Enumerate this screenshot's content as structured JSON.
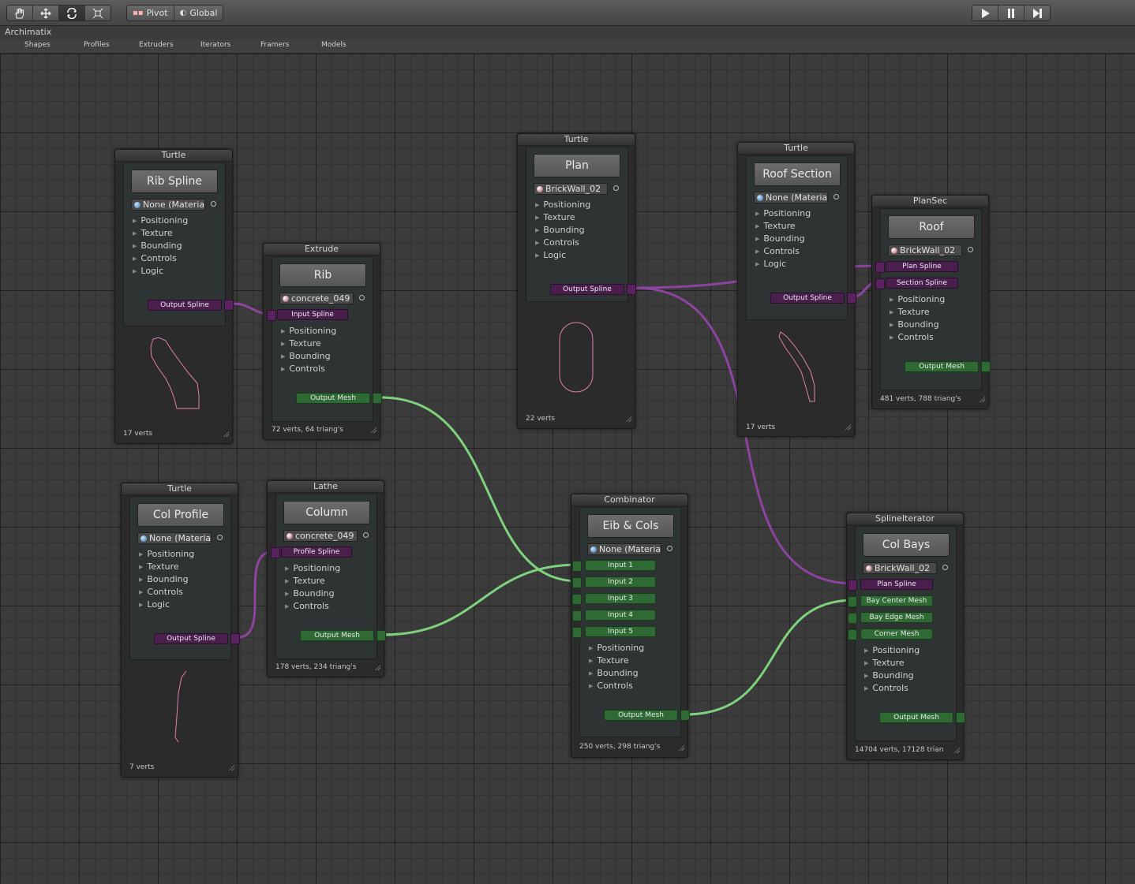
{
  "toolbar": {
    "tools": [
      "hand-icon",
      "move-icon",
      "rotate-icon",
      "scale-icon"
    ],
    "pivot": "Pivot",
    "global": "Global",
    "playback": [
      "play-icon",
      "pause-icon",
      "step-icon"
    ]
  },
  "window": {
    "title": "Archimatix"
  },
  "tabs": [
    "Shapes",
    "Profiles",
    "Extruders",
    "Iterators",
    "Framers",
    "Models"
  ],
  "colors": {
    "spline_wire": "#8c44a0",
    "mesh_wire": "#7ed27e",
    "shape_stroke": "#e47eb0"
  },
  "nodes": {
    "rib_spline": {
      "type": "Turtle",
      "name": "Rib Spline",
      "material": "None (Material",
      "items": [
        "Positioning",
        "Texture",
        "Bounding",
        "Controls",
        "Logic"
      ],
      "output": "Output Spline",
      "stats": "17 verts"
    },
    "rib": {
      "type": "Extrude",
      "name": "Rib",
      "material": "concrete_049",
      "input": "Input Spline",
      "items": [
        "Positioning",
        "Texture",
        "Bounding",
        "Controls"
      ],
      "output": "Output Mesh",
      "stats": "72 verts, 64 triang's"
    },
    "plan": {
      "type": "Turtle",
      "name": "Plan",
      "material": "BrickWall_02",
      "items": [
        "Positioning",
        "Texture",
        "Bounding",
        "Controls",
        "Logic"
      ],
      "output": "Output Spline",
      "stats": "22 verts"
    },
    "roof_section": {
      "type": "Turtle",
      "name": "Roof Section",
      "material": "None (Material",
      "items": [
        "Positioning",
        "Texture",
        "Bounding",
        "Controls",
        "Logic"
      ],
      "output": "Output Spline",
      "stats": "17 verts"
    },
    "roof": {
      "type": "PlanSec",
      "name": "Roof",
      "material": "BrickWall_02",
      "inputs": [
        "Plan Spline",
        "Section Spline"
      ],
      "items": [
        "Positioning",
        "Texture",
        "Bounding",
        "Controls"
      ],
      "output": "Output Mesh",
      "stats": "481 verts, 788 triang's"
    },
    "col_profile": {
      "type": "Turtle",
      "name": "Col Profile",
      "material": "None (Material",
      "items": [
        "Positioning",
        "Texture",
        "Bounding",
        "Controls",
        "Logic"
      ],
      "output": "Output Spline",
      "stats": "7 verts"
    },
    "column": {
      "type": "Lathe",
      "name": "Column",
      "material": "concrete_049",
      "input": "Profile Spline",
      "items": [
        "Positioning",
        "Texture",
        "Bounding",
        "Controls"
      ],
      "output": "Output Mesh",
      "stats": "178 verts, 234 triang's"
    },
    "eib_cols": {
      "type": "Combinator",
      "name": "Eib & Cols",
      "material": "None (Material",
      "inputs": [
        "Input 1",
        "Input 2",
        "Input 3",
        "Input 4",
        "Input 5"
      ],
      "items": [
        "Positioning",
        "Texture",
        "Bounding",
        "Controls"
      ],
      "output": "Output Mesh",
      "stats": "250 verts, 298 triang's"
    },
    "col_bays": {
      "type": "SplineIterator",
      "name": "Col Bays",
      "material": "BrickWall_02",
      "inputs": [
        "Plan Spline",
        "Bay Center Mesh",
        "Bay Edge Mesh",
        "Corner Mesh"
      ],
      "items": [
        "Positioning",
        "Texture",
        "Bounding",
        "Controls"
      ],
      "output": "Output Mesh",
      "stats": "14704 verts, 17128 trian"
    }
  }
}
